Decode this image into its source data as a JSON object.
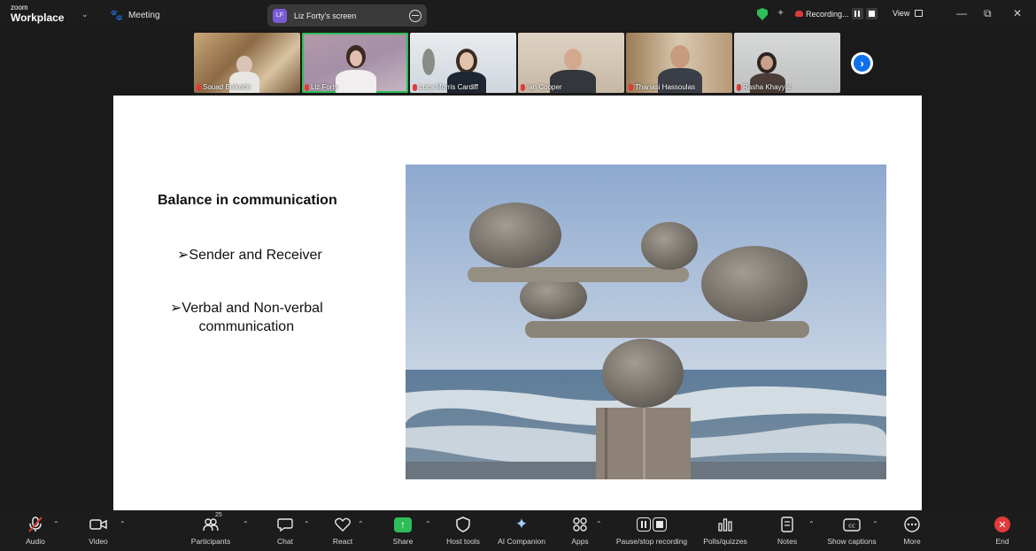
{
  "app": {
    "brand_line1": "zoom",
    "brand_line2": "Workplace"
  },
  "titlebar": {
    "meeting_label": "Meeting",
    "screen_label": "Liz Forty's screen",
    "screen_initials": "LF",
    "recording_label": "Recording...",
    "view_label": "View"
  },
  "participants": [
    {
      "name": "Souad Belkebir"
    },
    {
      "name": "Liz Forty"
    },
    {
      "name": "Lucy Morris Cardiff"
    },
    {
      "name": "Ian Cooper"
    },
    {
      "name": "Thanasi Hassoulas"
    },
    {
      "name": "Rasha Khayyat"
    }
  ],
  "slide": {
    "title": "Balance in communication",
    "bullet1": "➢Sender and Receiver",
    "bullet2_line1": "➢Verbal and Non-verbal",
    "bullet2_line2": "communication"
  },
  "toolbar": {
    "audio": "Audio",
    "video": "Video",
    "participants": "Participants",
    "participant_count": "25",
    "chat": "Chat",
    "react": "React",
    "share": "Share",
    "host_tools": "Host tools",
    "ai_companion": "AI Companion",
    "apps": "Apps",
    "pause_recording": "Pause/stop recording",
    "polls": "Polls/quizzes",
    "notes": "Notes",
    "captions": "Show captions",
    "more": "More",
    "end": "End"
  },
  "colors": {
    "accent_green": "#2ebd59",
    "end_red": "#e03a3a",
    "nav_blue": "#0e71eb"
  }
}
